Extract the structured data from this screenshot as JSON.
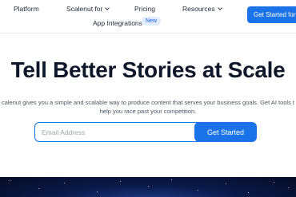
{
  "nav": {
    "platform": "Platform",
    "scalenut_for": "Scalenut for",
    "pricing": "Pricing",
    "resources": "Resources",
    "app_integrations": "App Integrations",
    "new_badge": "New",
    "cta": "Get Started for"
  },
  "hero": {
    "title_main": "Tell Better Stories at ",
    "title_highlight": "Scale",
    "subtitle_line1": "calenut gives you a simple and scalable way to produce content that serves your business goals. Get AI tools t",
    "subtitle_line2": "help you race past your competition."
  },
  "signup": {
    "email_placeholder": "Email Address",
    "email_value": "",
    "button_label": "Get Started"
  },
  "colors": {
    "accent": "#1a73e8",
    "highlight": "#5ad1ff",
    "badge_bg": "#e0ecff"
  }
}
